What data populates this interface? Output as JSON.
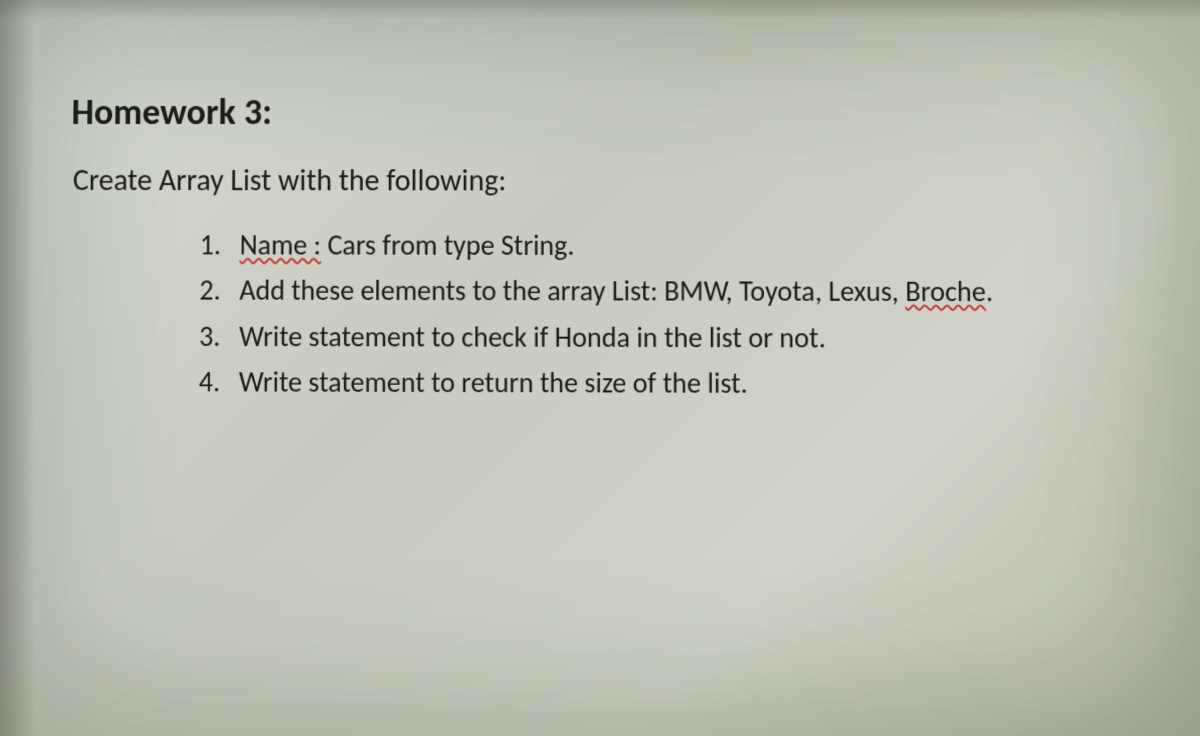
{
  "title": "Homework 3:",
  "subtitle": "Create Array List with the following:",
  "items": [
    {
      "prefix_underlined": "Name :",
      "rest": " Cars from type String."
    },
    {
      "text_before": "Add these elements to the array List: BMW, Toyota, Lexus, ",
      "underlined_end": "Broche",
      "text_after": "."
    },
    {
      "text": "Write statement to check if Honda in the list or not."
    },
    {
      "text": "Write statement to return the size of the list."
    }
  ]
}
